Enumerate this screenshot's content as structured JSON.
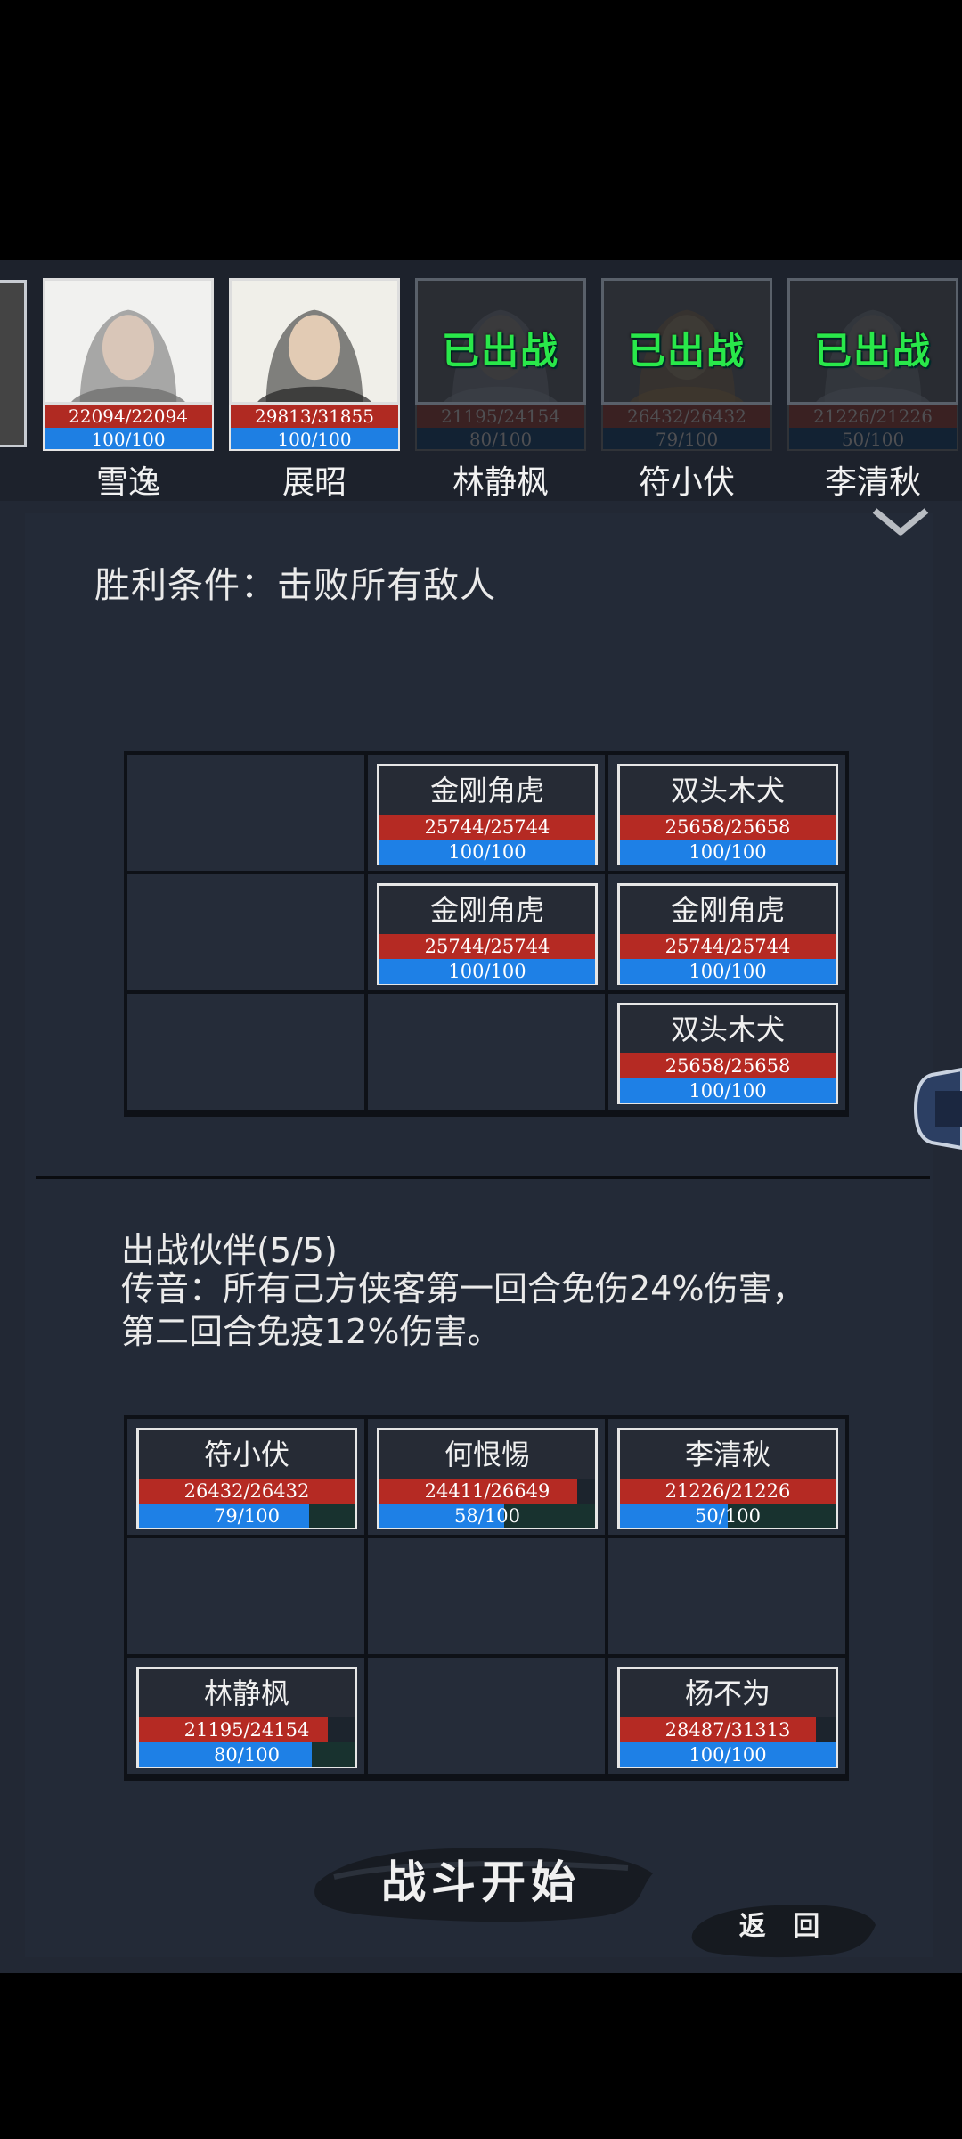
{
  "roster": {
    "heroes": [
      {
        "name": "雪逸",
        "hp": "22094/22094",
        "hp_frac": 1.0,
        "mp": "100/100",
        "mp_frac": 1.0,
        "deployed": false,
        "deployed_label": ""
      },
      {
        "name": "展昭",
        "hp": "29813/31855",
        "hp_frac": 0.936,
        "mp": "100/100",
        "mp_frac": 1.0,
        "deployed": false,
        "deployed_label": ""
      },
      {
        "name": "林静枫",
        "hp": "21195/24154",
        "hp_frac": 0.877,
        "mp": "80/100",
        "mp_frac": 0.8,
        "deployed": true,
        "deployed_label": "已出战"
      },
      {
        "name": "符小伏",
        "hp": "26432/26432",
        "hp_frac": 1.0,
        "mp": "79/100",
        "mp_frac": 0.79,
        "deployed": true,
        "deployed_label": "已出战"
      },
      {
        "name": "李清秋",
        "hp": "21226/21226",
        "hp_frac": 1.0,
        "mp": "50/100",
        "mp_frac": 0.5,
        "deployed": true,
        "deployed_label": "已出战"
      }
    ]
  },
  "victory_condition": "胜利条件：击败所有敌人",
  "enemy_grid": [
    [
      null,
      {
        "name": "金刚角虎",
        "hp": "25744/25744",
        "hp_frac": 1.0,
        "mp": "100/100",
        "mp_frac": 1.0
      },
      {
        "name": "双头木犬",
        "hp": "25658/25658",
        "hp_frac": 1.0,
        "mp": "100/100",
        "mp_frac": 1.0
      }
    ],
    [
      null,
      {
        "name": "金刚角虎",
        "hp": "25744/25744",
        "hp_frac": 1.0,
        "mp": "100/100",
        "mp_frac": 1.0
      },
      {
        "name": "金刚角虎",
        "hp": "25744/25744",
        "hp_frac": 1.0,
        "mp": "100/100",
        "mp_frac": 1.0
      }
    ],
    [
      null,
      null,
      {
        "name": "双头木犬",
        "hp": "25658/25658",
        "hp_frac": 1.0,
        "mp": "100/100",
        "mp_frac": 1.0
      }
    ]
  ],
  "partners": {
    "title": "出战伙伴(5/5)",
    "buff_text": "传音：所有己方侠客第一回合免伤24%伤害，第二回合免疫12%伤害。"
  },
  "ally_grid": [
    [
      {
        "name": "符小伏",
        "hp": "26432/26432",
        "hp_frac": 1.0,
        "mp": "79/100",
        "mp_frac": 0.79
      },
      {
        "name": "何恨惕",
        "hp": "24411/26649",
        "hp_frac": 0.916,
        "mp": "58/100",
        "mp_frac": 0.58
      },
      {
        "name": "李清秋",
        "hp": "21226/21226",
        "hp_frac": 1.0,
        "mp": "50/100",
        "mp_frac": 0.5
      }
    ],
    [
      null,
      null,
      null
    ],
    [
      {
        "name": "林静枫",
        "hp": "21195/24154",
        "hp_frac": 0.877,
        "mp": "80/100",
        "mp_frac": 0.8
      },
      null,
      {
        "name": "杨不为",
        "hp": "28487/31313",
        "hp_frac": 0.91,
        "mp": "100/100",
        "mp_frac": 1.0
      }
    ]
  ],
  "buttons": {
    "start": "战斗开始",
    "back": "返 回"
  },
  "colors": {
    "hp": "#b52a23",
    "mp": "#1e80e6",
    "deployed": "#29e84a",
    "panel": "#232a37"
  }
}
